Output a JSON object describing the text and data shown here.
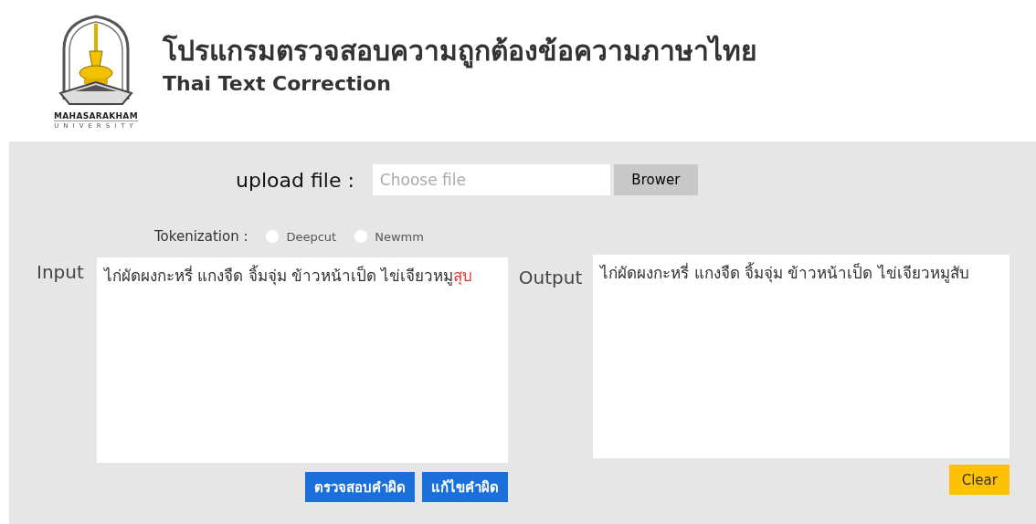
{
  "header": {
    "logo": {
      "name": "MAHASARAKHAM",
      "subtitle": "UNIVERSITY"
    },
    "title": "โปรแกรมตรวจสอบความถูกต้องข้อความภาษาไทย",
    "subtitle": "Thai Text Correction"
  },
  "upload": {
    "label": "upload file :",
    "placeholder": "Choose file",
    "button": "Brower"
  },
  "tokenization": {
    "label": "Tokenization :",
    "options": [
      {
        "label": "Deepcut",
        "selected": false
      },
      {
        "label": "Newmm",
        "selected": false
      }
    ]
  },
  "input": {
    "label": "Input",
    "segments": [
      {
        "kind": "normal",
        "text": "ไก่ผัดผงกะหรี่ แกงจืด จิ้มจุ่ม ข้าวหน้าเป็ด ไข่เจียวหมู"
      },
      {
        "kind": "error",
        "text": "สุบ"
      }
    ],
    "buttons": [
      "ตรวจสอบคำผิด",
      "แก้ไขคำผิด"
    ]
  },
  "output": {
    "label": "Output",
    "text": "ไก่ผัดผงกะหรี่ แกงจืด จิ้มจุ่ม ข้าวหน้าเป็ด ไข่เจียวหมูสับ",
    "button": "Clear"
  }
}
